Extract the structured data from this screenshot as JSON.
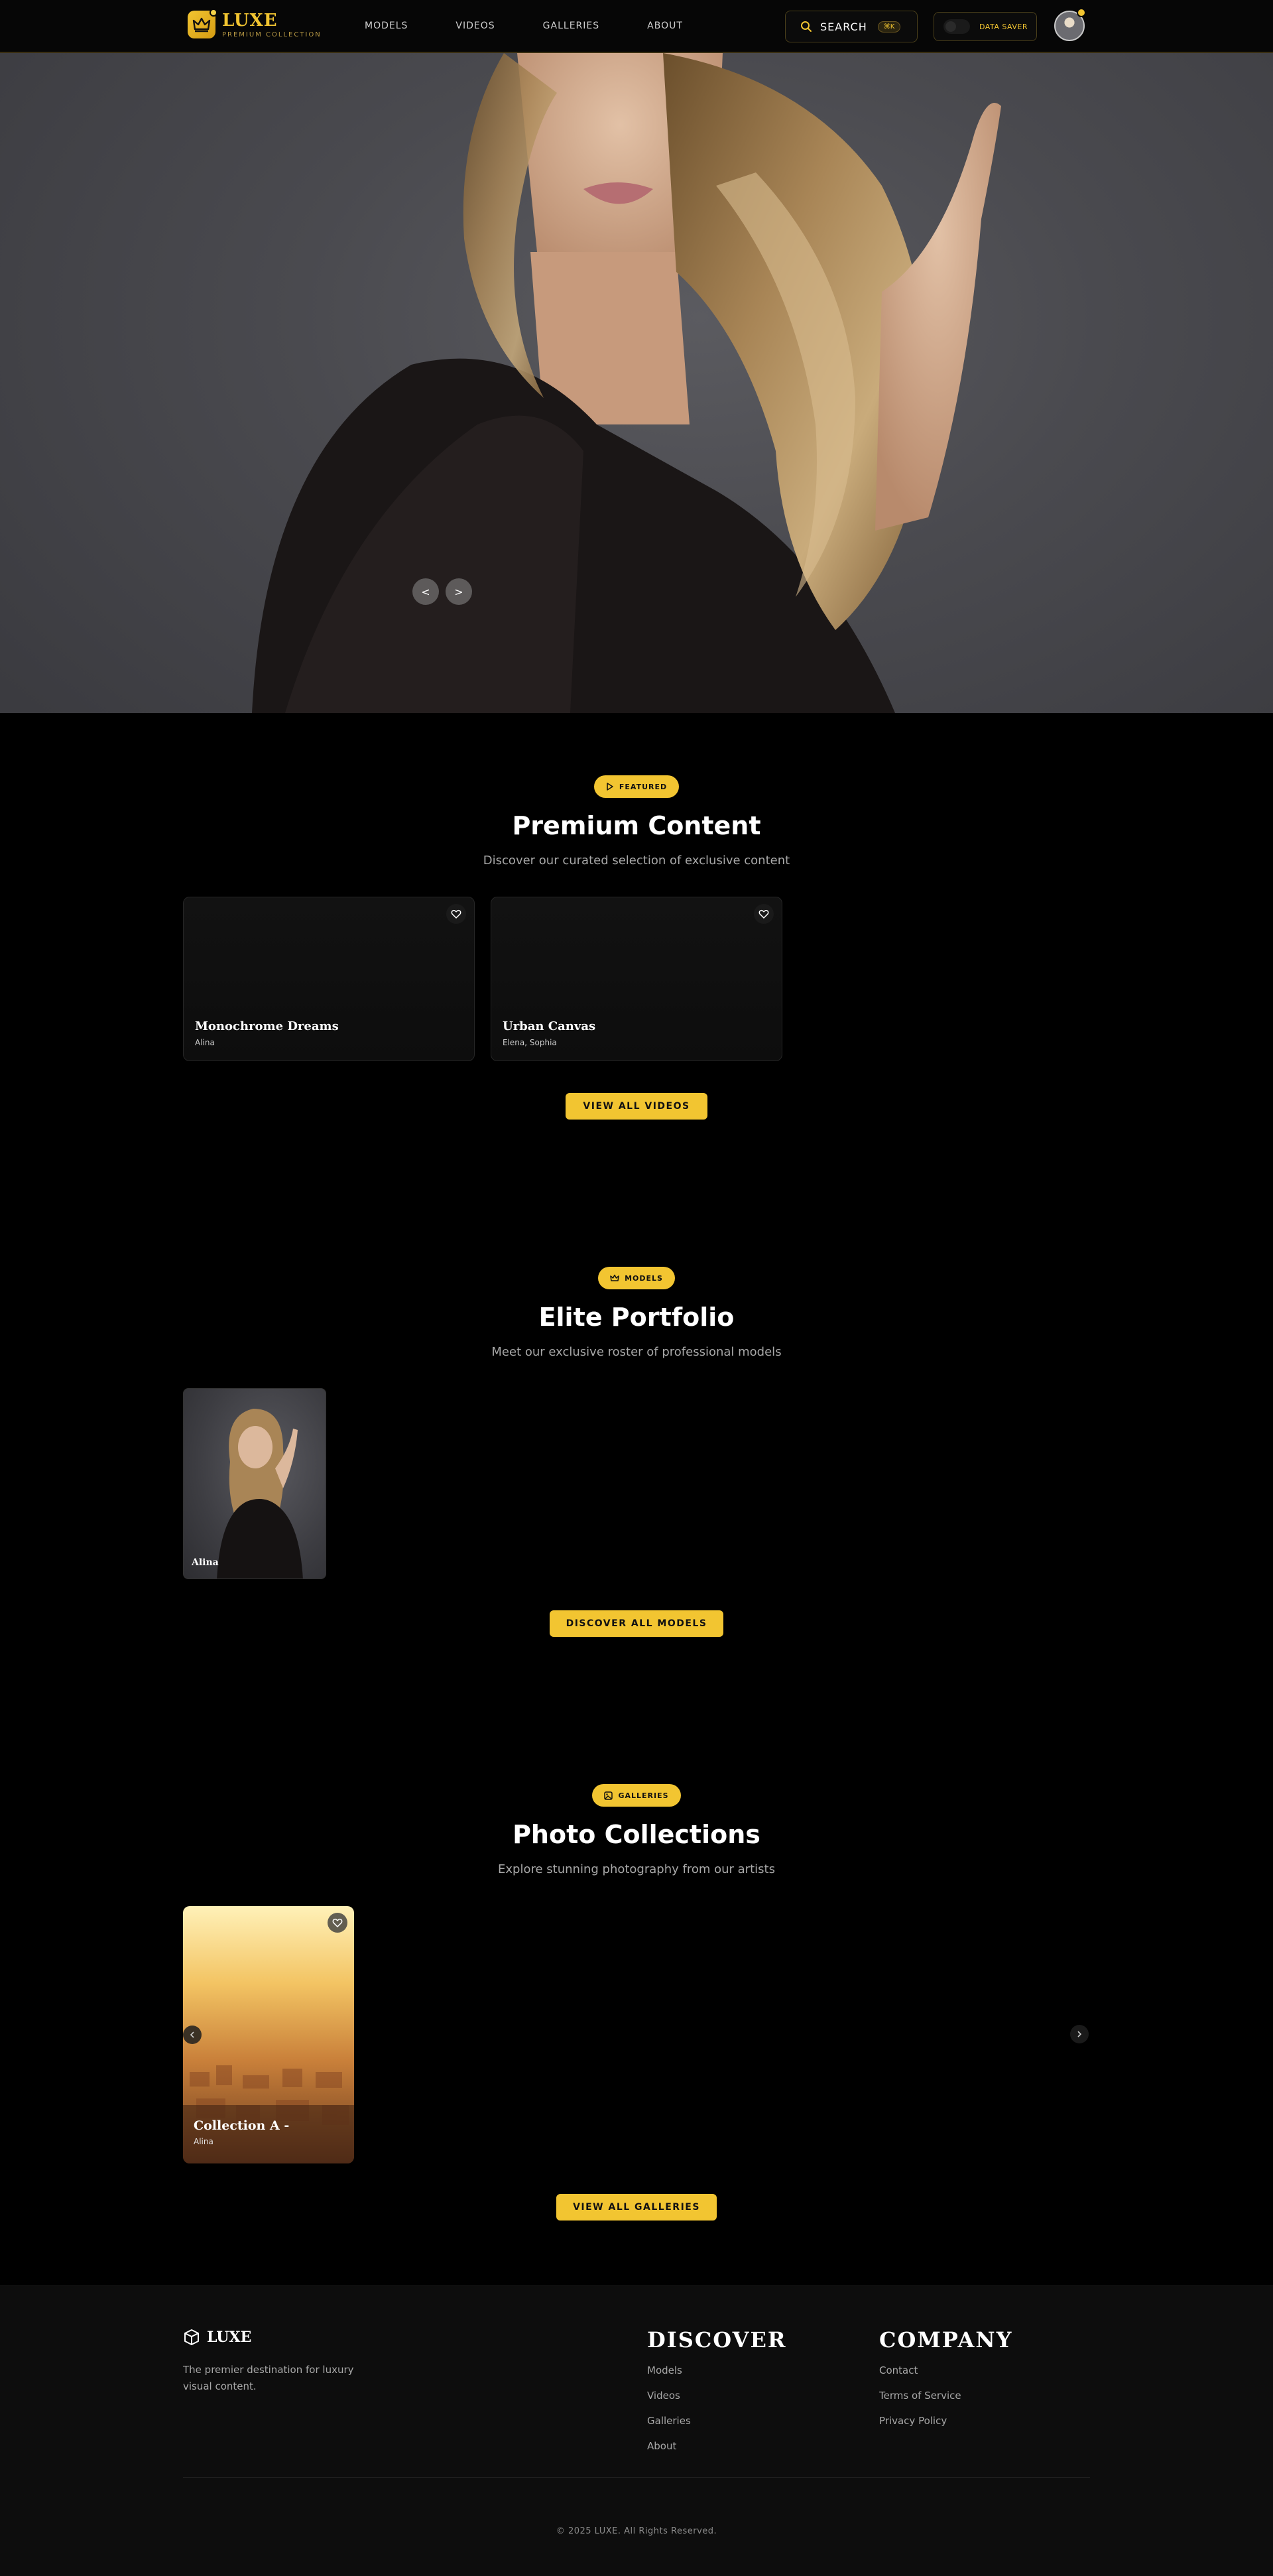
{
  "header": {
    "brand": {
      "name": "LUXE",
      "subtitle": "PREMIUM COLLECTION"
    },
    "nav": [
      {
        "label": "MODELS"
      },
      {
        "label": "VIDEOS"
      },
      {
        "label": "GALLERIES"
      },
      {
        "label": "ABOUT"
      }
    ],
    "search": {
      "label": "SEARCH",
      "shortcut": "⌘K"
    },
    "data_saver": {
      "label": "DATA SAVER",
      "enabled": false
    }
  },
  "hero": {
    "prev_label": "<",
    "next_label": ">"
  },
  "featured": {
    "badge": "FEATURED",
    "title": "Premium Content",
    "subtitle": "Discover our curated selection of exclusive content",
    "videos": [
      {
        "title": "Monochrome Dreams",
        "models": "Alina"
      },
      {
        "title": "Urban Canvas",
        "models": "Elena, Sophia"
      }
    ],
    "cta": "VIEW ALL VIDEOS"
  },
  "models": {
    "badge": "MODELS",
    "title": "Elite Portfolio",
    "subtitle": "Meet our exclusive roster of professional models",
    "items": [
      {
        "name": "Alina"
      }
    ],
    "cta": "DISCOVER ALL MODELS"
  },
  "galleries": {
    "badge": "GALLERIES",
    "title": "Photo Collections",
    "subtitle": "Explore stunning photography from our artists",
    "items": [
      {
        "title": "Collection A -",
        "model": "Alina"
      }
    ],
    "cta": "VIEW ALL GALLERIES"
  },
  "footer": {
    "brand": "LUXE",
    "tagline": "The premier destination for luxury visual content.",
    "discover": {
      "heading": "DISCOVER",
      "links": [
        "Models",
        "Videos",
        "Galleries",
        "About"
      ]
    },
    "company": {
      "heading": "COMPANY",
      "links": [
        "Contact",
        "Terms of Service",
        "Privacy Policy"
      ]
    },
    "copyright": "© 2025 LUXE. All Rights Reserved."
  },
  "colors": {
    "accent": "#f2c531",
    "background": "#000000",
    "footer": "#0d0d0d"
  }
}
